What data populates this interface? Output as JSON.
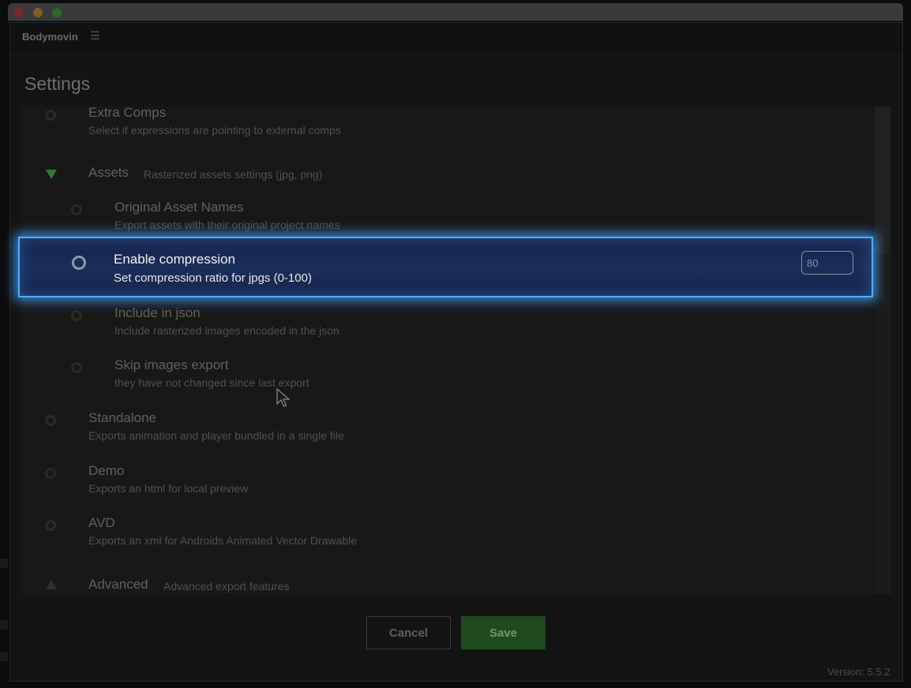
{
  "app": {
    "name": "Bodymovin",
    "menu_icon": "hamburger-menu-icon"
  },
  "page": {
    "title": "Settings"
  },
  "settings": {
    "extra_comps": {
      "title": "Extra Comps",
      "desc": "Select if expressions are pointing to external comps"
    },
    "assets": {
      "title": "Assets",
      "subtitle": "Rasterized assets settings (jpg, png)"
    },
    "original_asset_names": {
      "title": "Original Asset Names",
      "desc": "Export assets with their original project names"
    },
    "enable_compression": {
      "title": "Enable compression",
      "desc": "Set compression ratio for jpgs (0-100)",
      "value": "80"
    },
    "include_in_json": {
      "title": "Include in json",
      "desc": "Include rasterized images encoded in the json"
    },
    "skip_images_export": {
      "title": "Skip images export",
      "desc": "they have not changed since last export"
    },
    "standalone": {
      "title": "Standalone",
      "desc": "Exports animation and player bundled in a single file"
    },
    "demo": {
      "title": "Demo",
      "desc": "Exports an html for local preview"
    },
    "avd": {
      "title": "AVD",
      "desc": "Exports an xml for Androids Animated Vector Drawable"
    },
    "advanced": {
      "title": "Advanced",
      "subtitle": "Advanced export features"
    }
  },
  "buttons": {
    "cancel": "Cancel",
    "save": "Save"
  },
  "footer": {
    "version": "Version: 5.5.2"
  },
  "colors": {
    "highlight_border": "#4ab0ff",
    "save_bg": "#1f4a1f",
    "triangle_green": "#2f7a2f"
  }
}
